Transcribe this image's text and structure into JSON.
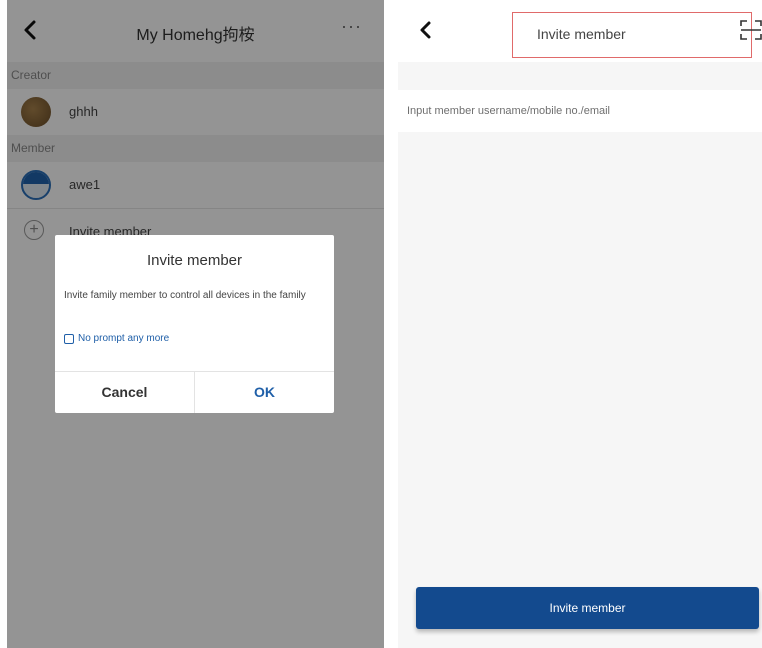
{
  "left": {
    "header": {
      "title": "My Homehg拘桉",
      "more": "···"
    },
    "creator_section": "Creator",
    "creator": {
      "name": "ghhh"
    },
    "member_section": "Member",
    "member": {
      "name": "awe1"
    },
    "invite_row": {
      "label": "Invite member"
    },
    "dialog": {
      "title": "Invite member",
      "message": "Invite family member to control all devices in the family",
      "checkbox_label": "No prompt any more",
      "cancel": "Cancel",
      "ok": "OK"
    }
  },
  "right": {
    "header": {
      "title": "Invite member"
    },
    "input": {
      "placeholder": "Input member username/mobile no./email",
      "value": ""
    },
    "button": "Invite member"
  },
  "icons": {
    "back": "chevron-left-icon",
    "more": "ellipsis-icon",
    "add": "plus-circle-icon",
    "scan": "scan-icon",
    "checkbox": "checkbox-icon"
  },
  "colors": {
    "accent": "#134a8e",
    "link_blue": "#1f5fa8",
    "highlight_border": "#e06a6a",
    "overlay": "rgba(0,0,0,0.42)"
  }
}
